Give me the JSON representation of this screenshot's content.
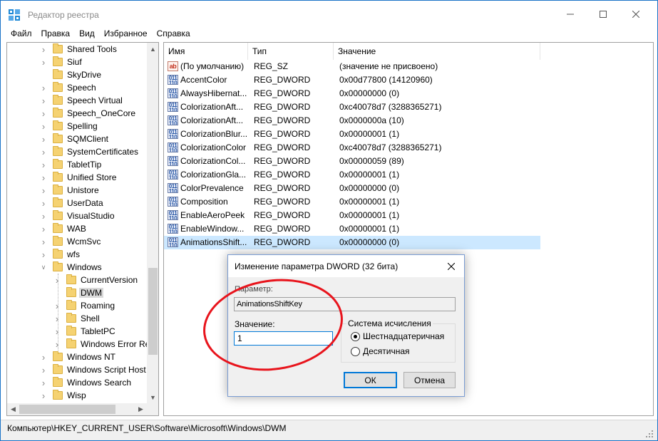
{
  "window": {
    "title": "Редактор реестра"
  },
  "menu": [
    "Файл",
    "Правка",
    "Вид",
    "Избранное",
    "Справка"
  ],
  "tree": {
    "items": [
      {
        "label": "Shared Tools",
        "level": 2,
        "expandable": true
      },
      {
        "label": "Siuf",
        "level": 2,
        "expandable": true
      },
      {
        "label": "SkyDrive",
        "level": 2,
        "expandable": false
      },
      {
        "label": "Speech",
        "level": 2,
        "expandable": true
      },
      {
        "label": "Speech Virtual",
        "level": 2,
        "expandable": true
      },
      {
        "label": "Speech_OneCore",
        "level": 2,
        "expandable": true
      },
      {
        "label": "Spelling",
        "level": 2,
        "expandable": true
      },
      {
        "label": "SQMClient",
        "level": 2,
        "expandable": true
      },
      {
        "label": "SystemCertificates",
        "level": 2,
        "expandable": true
      },
      {
        "label": "TabletTip",
        "level": 2,
        "expandable": true
      },
      {
        "label": "Unified Store",
        "level": 2,
        "expandable": true
      },
      {
        "label": "Unistore",
        "level": 2,
        "expandable": true
      },
      {
        "label": "UserData",
        "level": 2,
        "expandable": true
      },
      {
        "label": "VisualStudio",
        "level": 2,
        "expandable": true
      },
      {
        "label": "WAB",
        "level": 2,
        "expandable": true
      },
      {
        "label": "WcmSvc",
        "level": 2,
        "expandable": true
      },
      {
        "label": "wfs",
        "level": 2,
        "expandable": true
      },
      {
        "label": "Windows",
        "level": 2,
        "expandable": true,
        "expanded": true
      },
      {
        "label": "CurrentVersion",
        "level": 3,
        "expandable": true
      },
      {
        "label": "DWM",
        "level": 3,
        "expandable": false,
        "selected": true
      },
      {
        "label": "Roaming",
        "level": 3,
        "expandable": true
      },
      {
        "label": "Shell",
        "level": 3,
        "expandable": true
      },
      {
        "label": "TabletPC",
        "level": 3,
        "expandable": true
      },
      {
        "label": "Windows Error Re",
        "level": 3,
        "expandable": true
      },
      {
        "label": "Windows NT",
        "level": 2,
        "expandable": true
      },
      {
        "label": "Windows Script Host",
        "level": 2,
        "expandable": true
      },
      {
        "label": "Windows Search",
        "level": 2,
        "expandable": true
      },
      {
        "label": "Wisp",
        "level": 2,
        "expandable": true
      }
    ]
  },
  "list": {
    "columns": [
      "Имя",
      "Тип",
      "Значение"
    ],
    "rows": [
      {
        "name": "(По умолчанию)",
        "type": "REG_SZ",
        "value": "(значение не присвоено)",
        "icon": "string-value-icon"
      },
      {
        "name": "AccentColor",
        "type": "REG_DWORD",
        "value": "0x00d77800 (14120960)",
        "icon": "binary-value-icon"
      },
      {
        "name": "AlwaysHibernat...",
        "type": "REG_DWORD",
        "value": "0x00000000 (0)",
        "icon": "binary-value-icon"
      },
      {
        "name": "ColorizationAft...",
        "type": "REG_DWORD",
        "value": "0xc40078d7 (3288365271)",
        "icon": "binary-value-icon"
      },
      {
        "name": "ColorizationAft...",
        "type": "REG_DWORD",
        "value": "0x0000000a (10)",
        "icon": "binary-value-icon"
      },
      {
        "name": "ColorizationBlur...",
        "type": "REG_DWORD",
        "value": "0x00000001 (1)",
        "icon": "binary-value-icon"
      },
      {
        "name": "ColorizationColor",
        "type": "REG_DWORD",
        "value": "0xc40078d7 (3288365271)",
        "icon": "binary-value-icon"
      },
      {
        "name": "ColorizationCol...",
        "type": "REG_DWORD",
        "value": "0x00000059 (89)",
        "icon": "binary-value-icon"
      },
      {
        "name": "ColorizationGla...",
        "type": "REG_DWORD",
        "value": "0x00000001 (1)",
        "icon": "binary-value-icon"
      },
      {
        "name": "ColorPrevalence",
        "type": "REG_DWORD",
        "value": "0x00000000 (0)",
        "icon": "binary-value-icon"
      },
      {
        "name": "Composition",
        "type": "REG_DWORD",
        "value": "0x00000001 (1)",
        "icon": "binary-value-icon"
      },
      {
        "name": "EnableAeroPeek",
        "type": "REG_DWORD",
        "value": "0x00000001 (1)",
        "icon": "binary-value-icon"
      },
      {
        "name": "EnableWindow...",
        "type": "REG_DWORD",
        "value": "0x00000001 (1)",
        "icon": "binary-value-icon"
      },
      {
        "name": "AnimationsShift...",
        "type": "REG_DWORD",
        "value": "0x00000000 (0)",
        "icon": "binary-value-icon",
        "selected": true
      }
    ]
  },
  "statusbar": {
    "path": "Компьютер\\HKEY_CURRENT_USER\\Software\\Microsoft\\Windows\\DWM"
  },
  "dialog": {
    "title": "Изменение параметра DWORD (32 бита)",
    "param_label": "Параметр:",
    "param_value": "AnimationsShiftKey",
    "value_label": "Значение:",
    "value_input": "1",
    "base_group_title": "Система исчисления",
    "base_options": [
      {
        "label": "Шестнадцатеричная",
        "checked": true
      },
      {
        "label": "Десятичная",
        "checked": false
      }
    ],
    "ok_label": "ОК",
    "cancel_label": "Отмена"
  },
  "colors": {
    "accent": "#0078d7",
    "selection": "#cce8ff",
    "annotation": "#e8141c"
  }
}
